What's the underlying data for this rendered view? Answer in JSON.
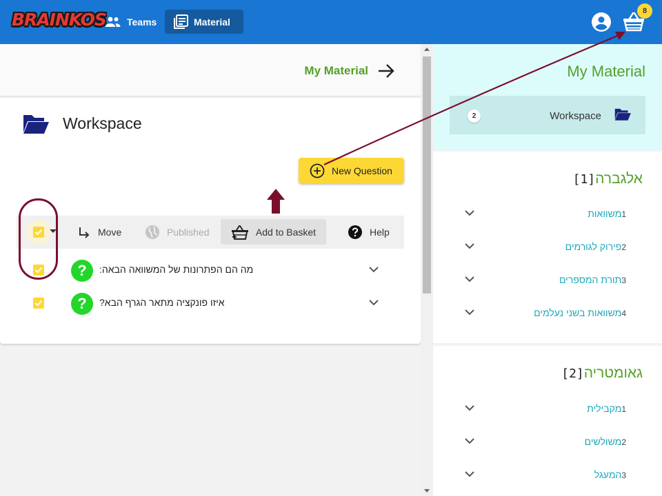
{
  "topbar": {
    "logo": "BRAINKOS",
    "nav": [
      {
        "label": "Teams",
        "icon": "people-icon"
      },
      {
        "label": "Material",
        "icon": "library-books-icon"
      }
    ],
    "basket_count": "8"
  },
  "left": {
    "my_material_label": "My Material",
    "workspace_title": "Workspace",
    "new_question_label": "New Question",
    "toolbar": {
      "move": "Move",
      "published": "Published",
      "add_to_basket": "Add to Basket",
      "help": "Help"
    },
    "questions": [
      {
        "text": "מה הם הפתרונות של המשוואה הבאה:"
      },
      {
        "text": "איזו פונקציה מתאר הגרף הבא?"
      }
    ]
  },
  "right": {
    "title": "My Material",
    "workspace": {
      "label": "Workspace",
      "count": "2"
    },
    "sections": [
      {
        "num": "[1]",
        "title": "אלגברה",
        "items": [
          {
            "n": "1",
            "label": "משוואות"
          },
          {
            "n": "2",
            "label": "פירוק לגורמים"
          },
          {
            "n": "3",
            "label": "תורת המספרים"
          },
          {
            "n": "4",
            "label": "משוואות בשני נעלמים"
          }
        ]
      },
      {
        "num": "[2]",
        "title": "גאומטריה",
        "items": [
          {
            "n": "1",
            "label": "מקבילית"
          },
          {
            "n": "2",
            "label": "משולשים"
          },
          {
            "n": "3",
            "label": "המעגל"
          }
        ]
      }
    ]
  },
  "colors": {
    "topbar": "#1976d2",
    "accent_green": "#55a02a",
    "basket_yellow": "#fdd835",
    "annotation": "#7a0f2b",
    "link_teal": "#1ca8b8"
  }
}
